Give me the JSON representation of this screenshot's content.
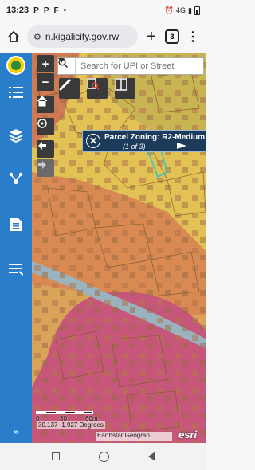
{
  "status": {
    "time": "13:23",
    "left_icons": [
      "P",
      "P",
      "F",
      "•"
    ],
    "right_text": "4G"
  },
  "browser": {
    "url": "n.kigalicity.gov.rw",
    "tab_count": "3",
    "home_icon": "home-icon",
    "add_icon": "plus-icon",
    "menu_icon": "more-vert-icon"
  },
  "sidebar": {
    "accent": "#2a7ec9",
    "items": [
      "logo",
      "list-icon",
      "layers-icon",
      "share-icon",
      "document-icon",
      "legend-icon",
      "expand-icon"
    ]
  },
  "map": {
    "search_placeholder": "Search for UPI or Street",
    "zoom_in": "+",
    "zoom_out": "−",
    "popup": {
      "title": "Parcel Zoning: R2-Medium d...",
      "pager": "(1 of 3)"
    },
    "scale": {
      "labels": [
        "0",
        "30",
        "60m"
      ]
    },
    "coordinates": "30.137 -1.927 Degrees",
    "attribution": "Earthstar Geograp...",
    "brand": "esri",
    "colors": {
      "zone_yellow": "#e2c254",
      "zone_orange": "#d98a52",
      "zone_pink": "#c7577a",
      "river": "#9bb3bf",
      "parcel_outline": "#7a5a28",
      "highlight": "#36c6c6"
    }
  }
}
